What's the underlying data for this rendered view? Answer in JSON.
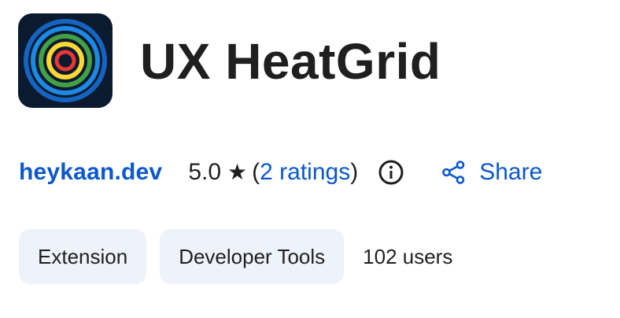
{
  "app": {
    "title": "UX HeatGrid",
    "icon": "concentric-rings-logo"
  },
  "meta": {
    "publisher": "heykaan.dev",
    "rating_value": "5.0",
    "star_glyph": "★",
    "ratings_open_paren": "(",
    "ratings_label": "2 ratings",
    "ratings_close_paren": ")",
    "info_icon": "info-icon",
    "share_label": "Share",
    "share_icon": "share-icon"
  },
  "chips": {
    "type_label": "Extension",
    "category_label": "Developer Tools",
    "users_label": "102 users"
  },
  "colors": {
    "link": "#0b57d0",
    "text": "#1f1f1f",
    "chip_bg": "#eef2fa",
    "icon_bg": "#0b1a2e",
    "ring_blue": "#1e88e5",
    "ring_green": "#43a047",
    "ring_yellow": "#fdd835",
    "ring_red": "#e53935"
  }
}
